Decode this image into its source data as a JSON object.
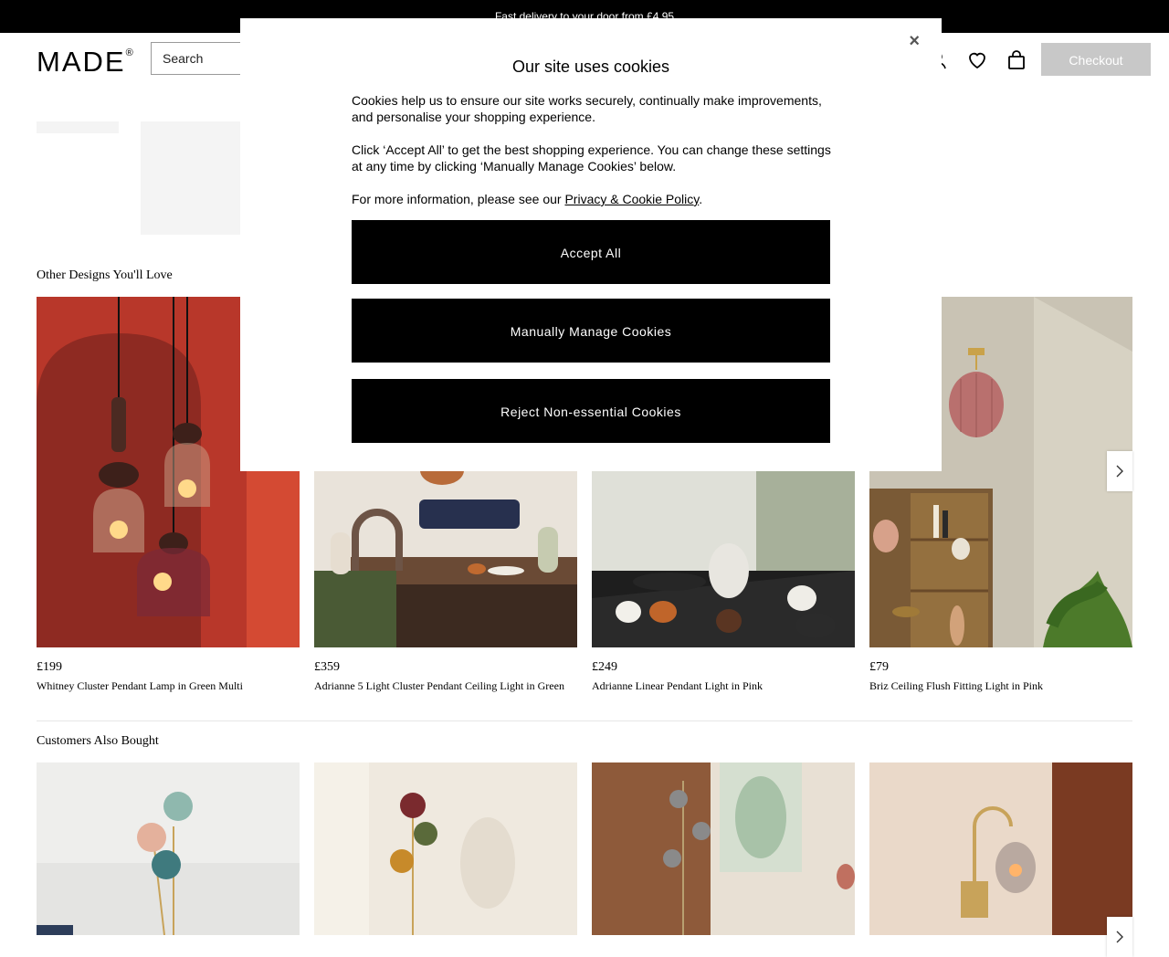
{
  "topbar": {
    "text": "Fast delivery to your door from £4.95"
  },
  "header": {
    "logo": "MADE",
    "logo_mark": "®",
    "search_placeholder": "Search",
    "checkout_label": "Checkout"
  },
  "sections": {
    "other": {
      "title": "Other Designs You'll Love"
    },
    "also": {
      "title": "Customers Also Bought"
    }
  },
  "products": [
    {
      "price": "£199",
      "name": "Whitney Cluster Pendant Lamp in Green Multi"
    },
    {
      "price": "£359",
      "name": "Adrianne 5 Light Cluster Pendant Ceiling Light in Green"
    },
    {
      "price": "£249",
      "name": "Adrianne Linear Pendant Light in Pink"
    },
    {
      "price": "£79",
      "name": "Briz Ceiling Flush Fitting Light in Pink"
    }
  ],
  "modal": {
    "title": "Our site uses cookies",
    "close": "×",
    "para1": "Cookies help us to ensure our site works securely, continually make improvements, and personalise your shopping experience.",
    "para2": "Click ‘Accept All’ to get the best shopping experience. You can change these settings at any time by clicking ‘Manually Manage Cookies’ below.",
    "para3_prefix": "For more information, please see our ",
    "para3_link": "Privacy & Cookie Policy",
    "para3_suffix": ".",
    "accept": "Accept All",
    "manage": "Manually Manage Cookies",
    "reject": "Reject Non-essential Cookies"
  },
  "colors": {
    "topbar": "#000000",
    "checkout_bg": "#c8c8c8",
    "button": "#000000"
  },
  "icons": [
    "account-icon",
    "heart-icon",
    "bag-icon",
    "chevron-right-icon",
    "close-icon"
  ]
}
